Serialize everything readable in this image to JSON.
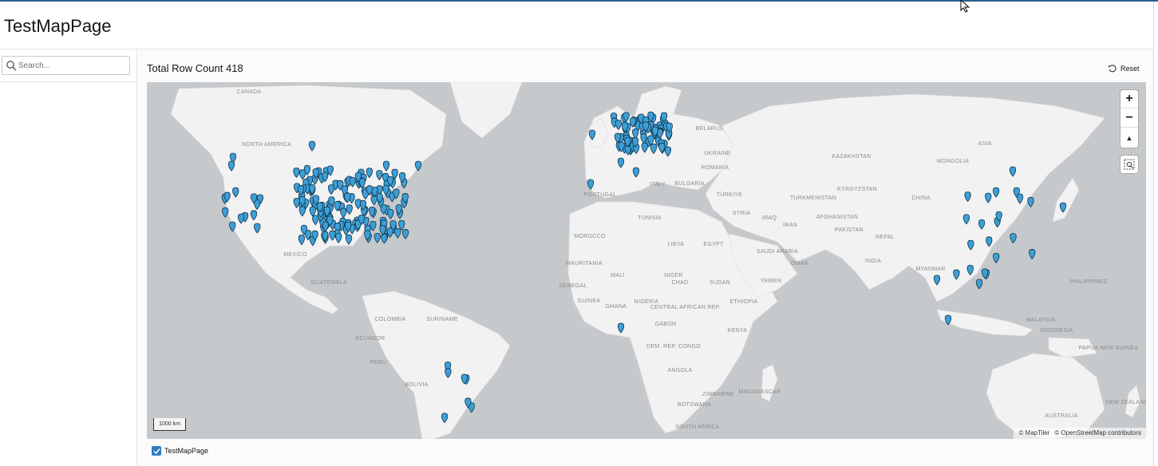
{
  "page": {
    "title": "TestMapPage"
  },
  "search": {
    "placeholder": "Search..."
  },
  "main": {
    "row_count_label": "Total Row Count 418",
    "reset_label": "Reset"
  },
  "map": {
    "zoom_in": "+",
    "zoom_out": "−",
    "north": "▲",
    "scale_label": "1000 km",
    "attribution": [
      "© MapTiler",
      "© OpenStreetMap contributors"
    ],
    "marker_color": "#3d9fd6",
    "labels": [
      {
        "text": "CANADA"
      },
      {
        "text": "NORTH AMERICA"
      },
      {
        "text": "MEXICO"
      },
      {
        "text": "GUATEMALA"
      },
      {
        "text": "COLOMBIA"
      },
      {
        "text": "SURINAME"
      },
      {
        "text": "ECUADOR"
      },
      {
        "text": "PERU"
      },
      {
        "text": "BOLIVIA"
      },
      {
        "text": "PORTUGAL"
      },
      {
        "text": "TUNISIA"
      },
      {
        "text": "MOROCCO"
      },
      {
        "text": "LIBYA"
      },
      {
        "text": "EGYPT"
      },
      {
        "text": "MAURITANIA"
      },
      {
        "text": "MALI"
      },
      {
        "text": "NIGER"
      },
      {
        "text": "CHAD"
      },
      {
        "text": "SUDAN"
      },
      {
        "text": "ETHIOPIA"
      },
      {
        "text": "SENEGAL"
      },
      {
        "text": "GUINEA"
      },
      {
        "text": "GHANA"
      },
      {
        "text": "NIGERIA"
      },
      {
        "text": "CENTRAL AFRICAN REP."
      },
      {
        "text": "GABON"
      },
      {
        "text": "DEM. REP. CONGO"
      },
      {
        "text": "KENYA"
      },
      {
        "text": "ANGOLA"
      },
      {
        "text": "ZIMBABWE"
      },
      {
        "text": "BOTSWANA"
      },
      {
        "text": "SOUTH AFRICA"
      },
      {
        "text": "MADAGASCAR"
      },
      {
        "text": "BELARUS"
      },
      {
        "text": "UKRAINE"
      },
      {
        "text": "ROMANIA"
      },
      {
        "text": "BULGARIA"
      },
      {
        "text": "TÜRKIYE"
      },
      {
        "text": "SYRIA"
      },
      {
        "text": "IRAQ"
      },
      {
        "text": "SAUDI ARABIA"
      },
      {
        "text": "YEMEN"
      },
      {
        "text": "OMAN"
      },
      {
        "text": "IRAN"
      },
      {
        "text": "TURKMENISTAN"
      },
      {
        "text": "KAZAKHSTAN"
      },
      {
        "text": "KYRGYZSTAN"
      },
      {
        "text": "AFGHANISTAN"
      },
      {
        "text": "PAKISTAN"
      },
      {
        "text": "INDIA"
      },
      {
        "text": "NEPAL"
      },
      {
        "text": "MYANMAR"
      },
      {
        "text": "CHINA"
      },
      {
        "text": "MONGOLIA"
      },
      {
        "text": "ASIA"
      },
      {
        "text": "PHILIPPINES"
      },
      {
        "text": "MALAYSIA"
      },
      {
        "text": "INDONESIA"
      },
      {
        "text": "PAPUA NEW GUINEA"
      },
      {
        "text": "AUSTRALIA"
      },
      {
        "text": "NEW ZEALAND"
      },
      {
        "text": "ITALY"
      }
    ]
  },
  "legend": {
    "label": "TestMapPage"
  }
}
